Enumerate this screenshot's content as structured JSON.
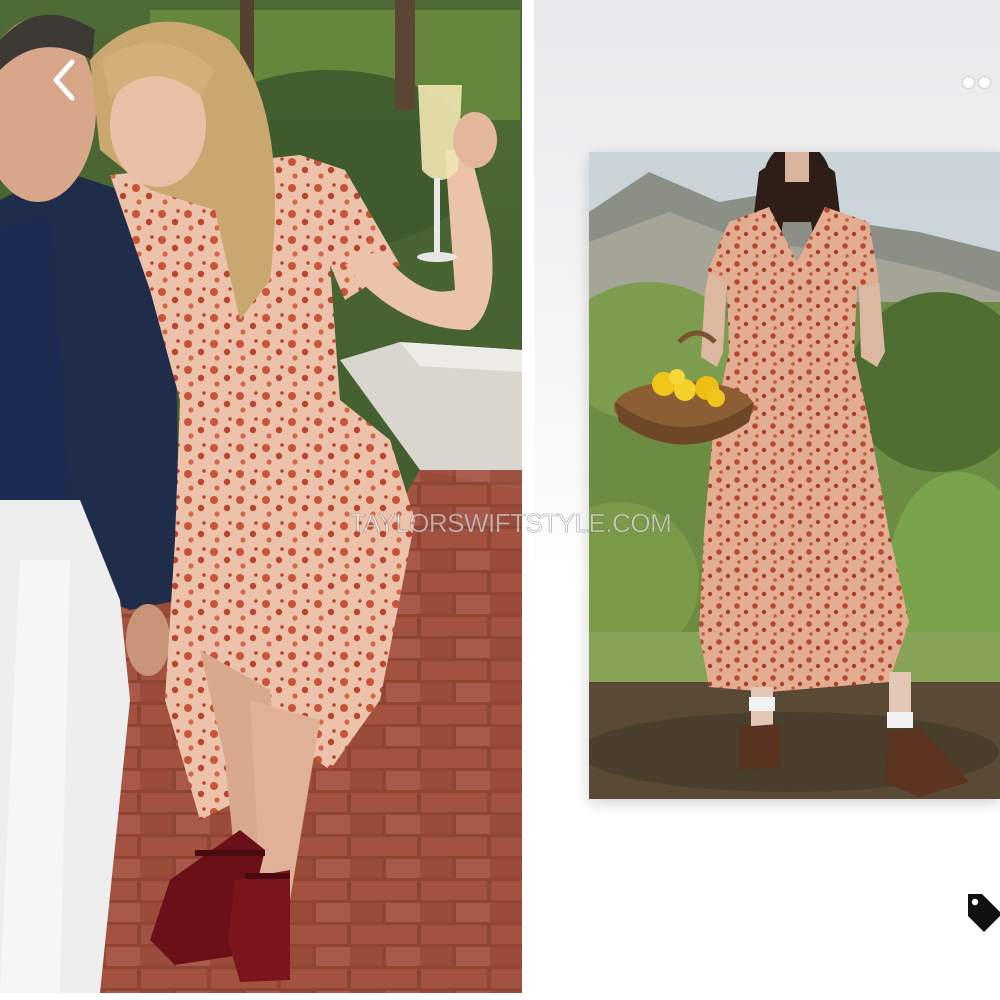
{
  "viewer": {
    "watermark_text": "TAYLORSWIFTSTYLE.COM",
    "controls": {
      "back_icon": "chevron-left-icon",
      "more_icon": "more-dots-icon",
      "tag_icon": "price-tag-icon"
    }
  },
  "colors": {
    "dress": "#e6b59c",
    "dress_print": "#c8553a",
    "brick": "#9a4a37",
    "foliage": "#5d7a3e",
    "jacket": "#1f2d4a",
    "shoes": "#6b1018"
  }
}
